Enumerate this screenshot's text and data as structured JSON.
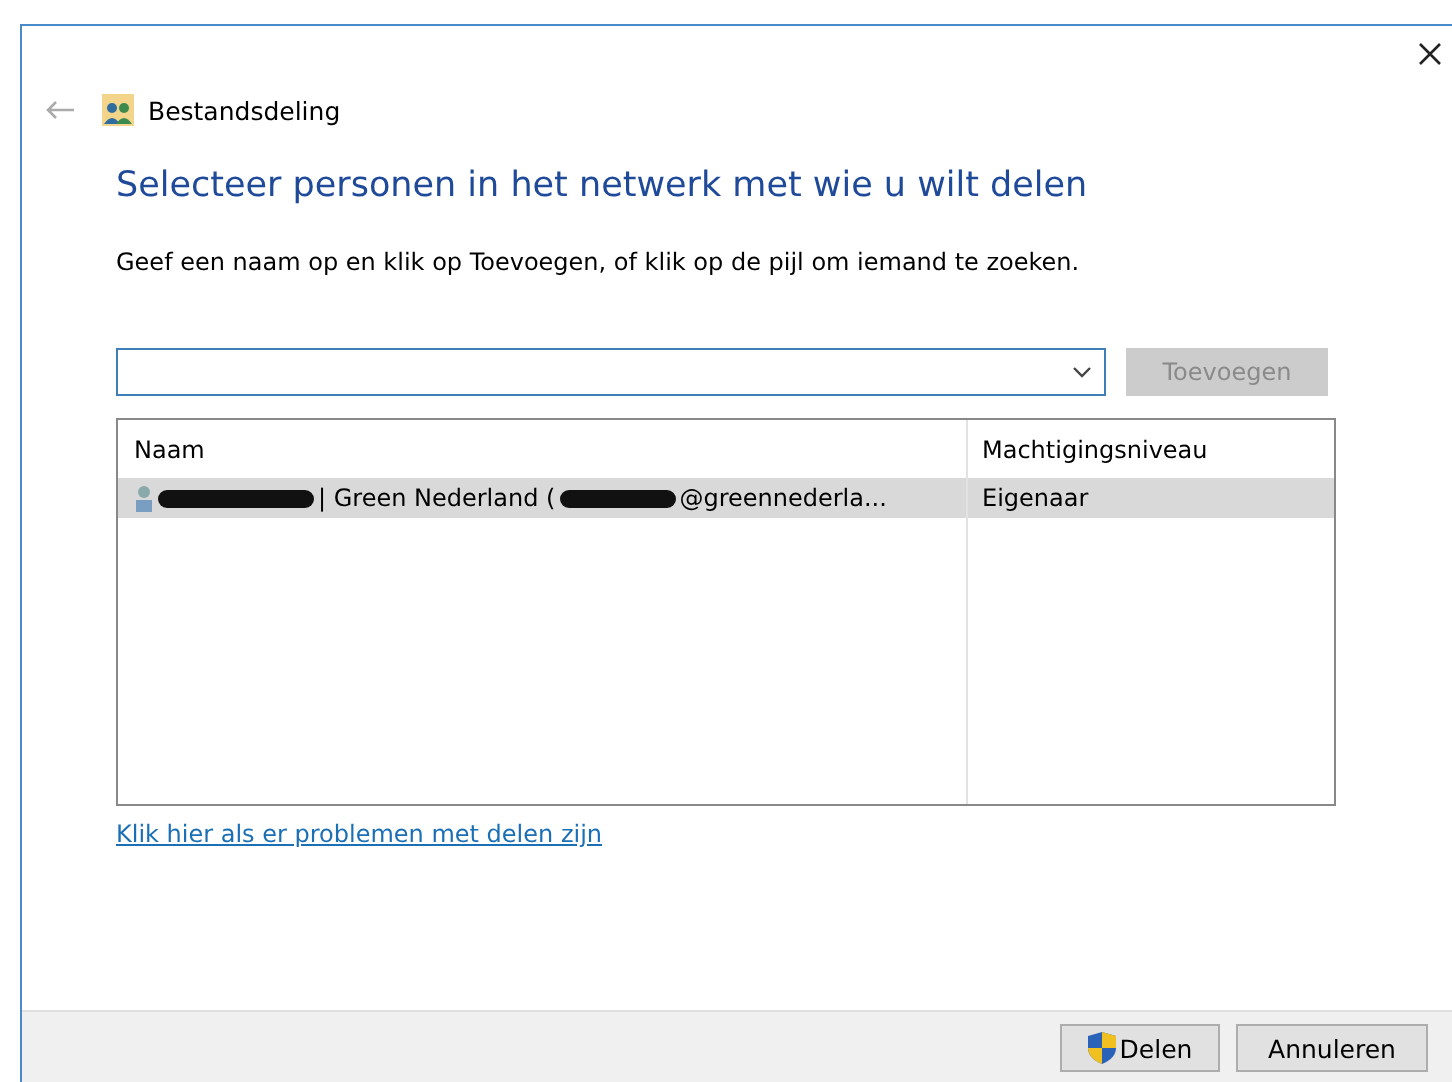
{
  "window": {
    "title": "Bestandsdeling"
  },
  "heading": "Selecteer personen in het netwerk met wie u wilt delen",
  "instruction": "Geef een naam op en klik op Toevoegen, of klik op de pijl om iemand te zoeken.",
  "add_button": {
    "label": "Toevoegen",
    "disabled": true
  },
  "table": {
    "columns": [
      "Naam",
      "Machtigingsniveau"
    ],
    "rows": [
      {
        "name_parts": [
          "| Green Nederland (",
          "@greennederla..."
        ],
        "permission": "Eigenaar",
        "selected": true
      }
    ]
  },
  "help_link": "Klik hier als er problemen met delen zijn",
  "buttons": [
    {
      "label": "Delen",
      "kind": "shield"
    },
    {
      "label": "Annuleren",
      "kind": "plain"
    }
  ]
}
